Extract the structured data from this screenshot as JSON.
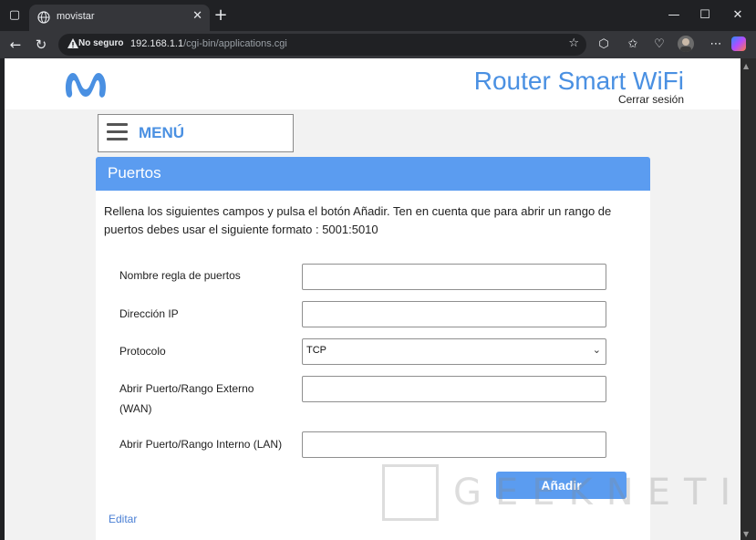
{
  "browser": {
    "tab_title": "movistar",
    "tab_close": "✕",
    "new_tab": "+",
    "window_controls": {
      "minimize": "—",
      "maximize": "☐",
      "close": "✕"
    },
    "security_label": "No seguro",
    "url_host": "192.168.1.1",
    "url_path": "/cgi-bin/applications.cgi",
    "icons": [
      "back-icon",
      "reload-icon",
      "warning-icon",
      "favorite-star-icon",
      "extensions-icon",
      "favorites-icon",
      "health-icon",
      "profile-avatar",
      "copilot-icon",
      "more-icon"
    ]
  },
  "header": {
    "brand": "Router Smart WiFi",
    "logout": "Cerrar sesión",
    "brand_color": "#4a90e2"
  },
  "menu": {
    "label": "MENÚ"
  },
  "panel": {
    "title": "Puertos",
    "intro": "Rellena los siguientes campos y pulsa el botón Añadir. Ten en cuenta que para abrir un rango de puertos debes usar el siguiente formato : 5001:5010",
    "accent": "#5b9cf0"
  },
  "form": {
    "rule_name_label": "Nombre regla de puertos",
    "rule_name_value": "",
    "ip_label": "Dirección IP",
    "ip_value": "",
    "protocol_label": "Protocolo",
    "protocol_value": "TCP",
    "wan_label_line1": "Abrir Puerto/Rango Externo",
    "wan_label_line2": "(WAN)",
    "wan_value": "",
    "lan_label": "Abrir Puerto/Rango Interno (LAN)",
    "lan_value": "",
    "add_label": "Añadir",
    "edit_label": "Editar"
  },
  "watermark": {
    "text": "GEEKNETIC",
    "glyph": "E"
  }
}
